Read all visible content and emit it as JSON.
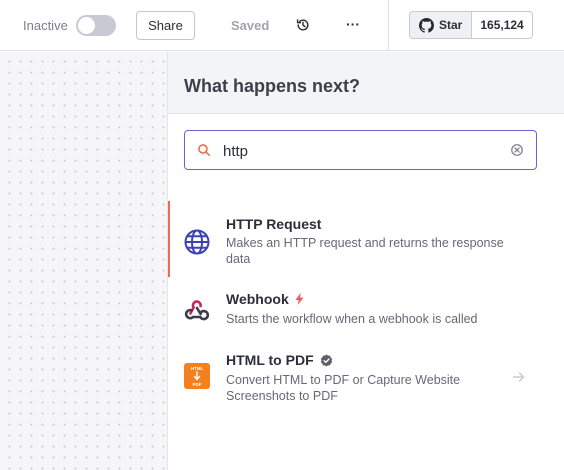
{
  "topbar": {
    "inactive_label": "Inactive",
    "share_label": "Share",
    "saved_label": "Saved",
    "github": {
      "star_label": "Star",
      "star_count": "165,124"
    }
  },
  "panel": {
    "title": "What happens next?",
    "search": {
      "value": "http",
      "placeholder": "Search nodes..."
    },
    "nodes": [
      {
        "title": "HTTP Request",
        "description": "Makes an HTTP request and returns the response data",
        "icon": "globe-icon",
        "active": true
      },
      {
        "title": "Webhook",
        "description": "Starts the workflow when a webhook is called",
        "icon": "webhook-icon",
        "badge": "trigger-bolt-icon"
      },
      {
        "title": "HTML to PDF",
        "description": "Convert HTML to PDF or Capture Website Screenshots to PDF",
        "icon": "html-to-pdf-icon",
        "badge": "verified-check-icon"
      }
    ]
  },
  "colors": {
    "accent": "#6a63d6",
    "active_marker": "#ee6a52",
    "globe": "#3b41b6",
    "html_pdf_orange": "#f5801f",
    "bolt": "#f05a5a"
  }
}
